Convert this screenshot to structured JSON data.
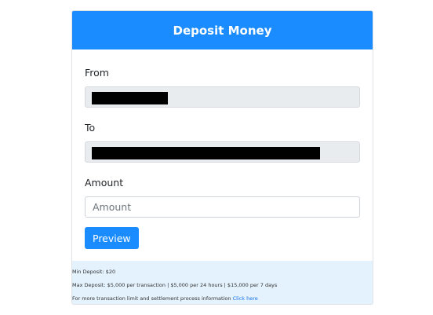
{
  "header": {
    "title": "Deposit Money"
  },
  "form": {
    "from_label": "From",
    "to_label": "To",
    "amount_label": "Amount",
    "amount_placeholder": "Amount",
    "amount_value": "",
    "preview_button": "Preview"
  },
  "footer": {
    "min_deposit": "Min Deposit: $20",
    "max_deposit": "Max Deposit: $5,000 per transaction | $5,000 per 24 hours | $15,000 per 7 days",
    "info_text": "For more transaction limit and settlement process information",
    "info_link": "Click here"
  },
  "colors": {
    "accent": "#1a8cff",
    "footer_bg": "#e3f2fd",
    "readonly_bg": "#e9ecef"
  }
}
